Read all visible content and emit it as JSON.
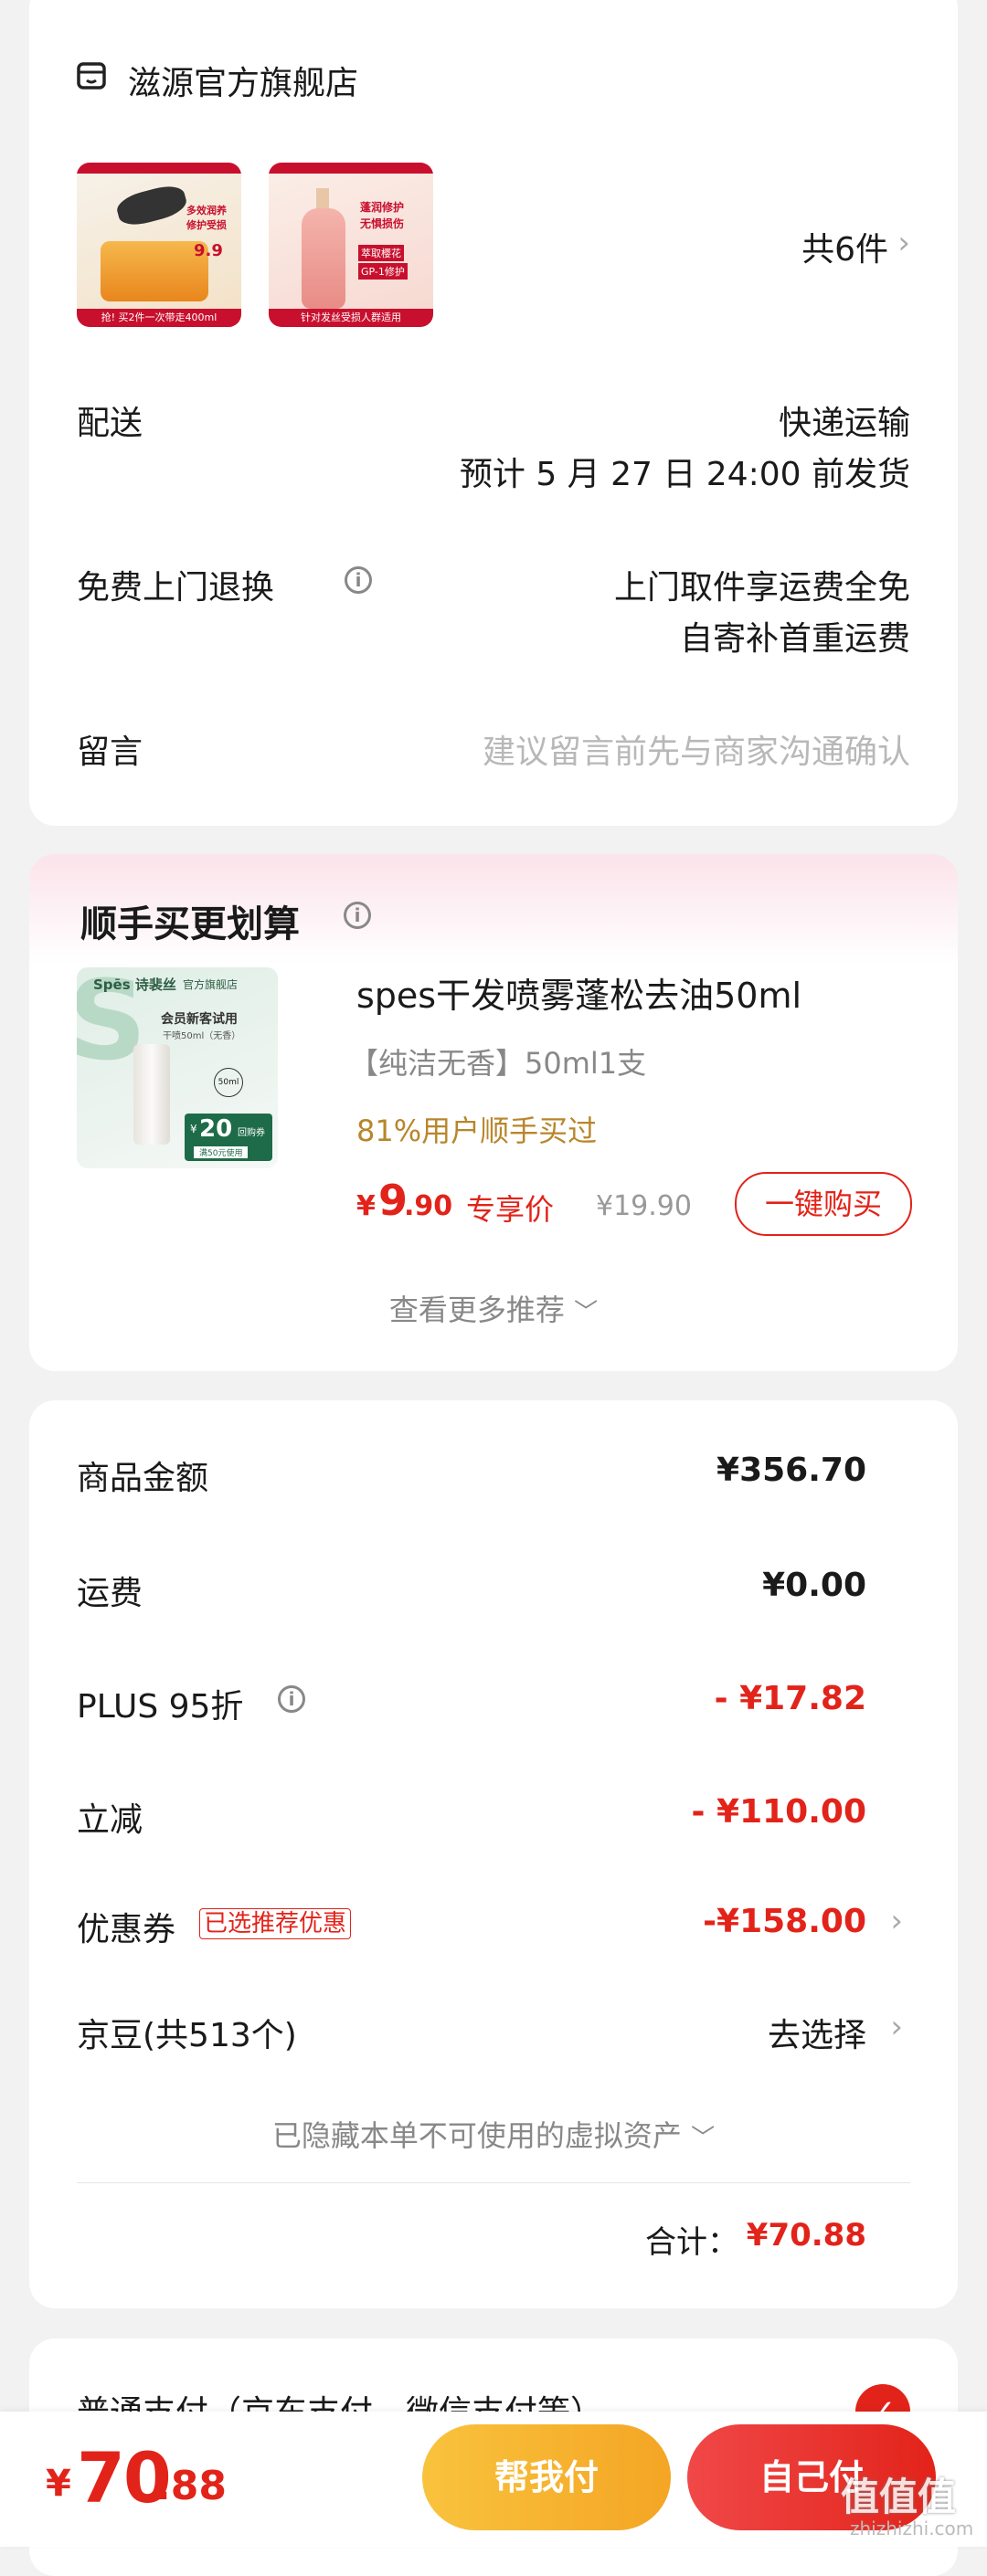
{
  "store": {
    "name": "滋源官方旗舰店",
    "count_text": "共6件"
  },
  "shipping": {
    "label": "配送",
    "method": "快递运输",
    "eta": "预计 5 月 27 日 24:00 前发货"
  },
  "returns": {
    "label": "免费上门退换",
    "line1": "上门取件享运费全免",
    "line2": "自寄补首重运费"
  },
  "message": {
    "label": "留言",
    "placeholder": "建议留言前先与商家沟通确认"
  },
  "products": [
    {
      "banner": "抢! 买2件一次带走400ml",
      "tag1": "多效润养",
      "tag2": "修护受损",
      "price_tag": "9.9"
    },
    {
      "banner": "针对发丝受损人群适用",
      "tag1": "蓬润修护",
      "tag2": "无惧损伤",
      "tag3": "萃取樱花",
      "tag4": "GP-1修护"
    }
  ],
  "recommend": {
    "title": "顺手买更划算",
    "product_name": "spes干发喷雾蓬松去油50ml",
    "spec": "【纯洁无香】50ml1支",
    "bought": "81%用户顺手买过",
    "currency": "¥",
    "price_int": "9",
    "price_dec": ".90",
    "exclusive": "专享价",
    "orig_price": "¥19.90",
    "buy_btn": "一键购买",
    "more": "查看更多推荐",
    "img_brand": "Spēs 诗裴丝",
    "img_store": "官方旗舰店",
    "img_trial": "会员新客试用",
    "img_sub": "干喷50ml（无香）",
    "img_size": "50ml",
    "img_coupon": "20",
    "img_coupon_label": "回购券",
    "img_coupon_cond": "满50元使用",
    "img_symbol": "¥"
  },
  "summary": {
    "goods_label": "商品金额",
    "goods_value": "¥356.70",
    "freight_label": "运费",
    "freight_value": "¥0.00",
    "plus_label": "PLUS 95折",
    "plus_value": "- ¥17.82",
    "cut_label": "立减",
    "cut_value": "- ¥110.00",
    "coupon_label": "优惠券",
    "coupon_tag": "已选推荐优惠",
    "coupon_value": "-¥158.00",
    "jd_label": "京豆(共513个)",
    "jd_value": "去选择",
    "hidden_text": "已隐藏本单不可使用的虚拟资产",
    "total_label": "合计：",
    "total_value": "¥70.88"
  },
  "payment": {
    "method_text": "普通支付（京东支付、微信支付等）"
  },
  "bottom": {
    "currency": "¥",
    "price_int": "70",
    "price_dec": ".88",
    "help_btn": "帮我付",
    "self_btn": "自己付",
    "watermark_text": "值值值",
    "watermark_url": "zhizhizhi.com"
  },
  "colors": {
    "accent": "#e2231a",
    "gold": "#b8862b",
    "help_btn": "#f7b733"
  }
}
